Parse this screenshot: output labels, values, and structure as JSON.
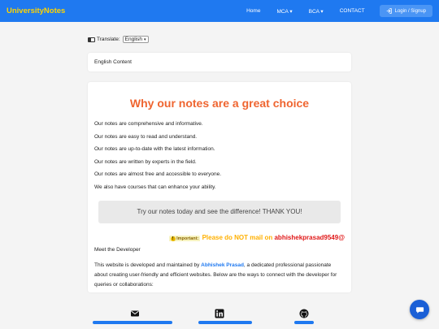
{
  "navbar": {
    "brand": "UniversityNotes",
    "links": [
      "Home",
      "MCA ▾",
      "BCA ▾",
      "CONTACT"
    ],
    "login_label": "Login / Signup"
  },
  "translate": {
    "label": "Translate:",
    "selected": "English"
  },
  "language_card": {
    "text": "English Content"
  },
  "main": {
    "title": "Why our notes are a great choice",
    "points": [
      "Our notes are comprehensive and informative.",
      "Our notes are easy to read and understand.",
      "Our notes are up-to-date with the latest information.",
      "Our notes are written by experts in the field.",
      "Our notes are almost free and accessible to everyone.",
      "We also have courses that can enhance your ability."
    ],
    "cta": "Try our notes today and see the difference! THANK YOU!",
    "important_badge": "Important:",
    "important_text": "Please do NOT mail on",
    "email": "abhishekprasad9549@",
    "meet_heading": "Meet the Developer",
    "about_prefix": "This website is developed and maintained by ",
    "developer_name": "Abhishek Prasad",
    "about_suffix": ", a dedicated professional passionate about creating user-friendly and efficient websites. Below are the ways to connect with the developer for queries or collaborations:"
  },
  "contacts": {
    "icons": [
      "mail-icon",
      "linkedin-icon",
      "github-icon"
    ]
  },
  "colors": {
    "navbar": "#1f79f0",
    "brand": "#ffd400",
    "title": "#ef6530",
    "important": "#ffb000",
    "email": "#e01818",
    "link": "#1f79f0"
  }
}
